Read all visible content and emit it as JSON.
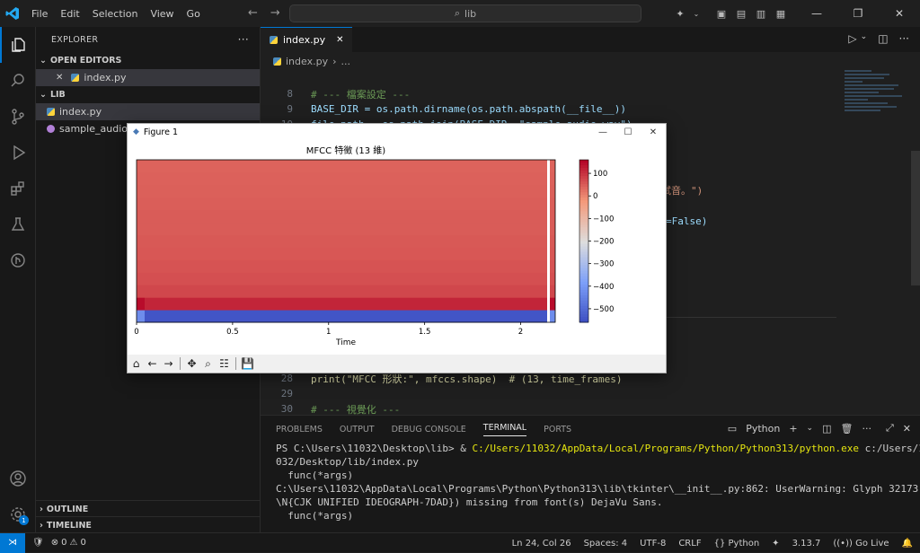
{
  "menu": [
    "File",
    "Edit",
    "Selection",
    "View",
    "Go"
  ],
  "search": {
    "text": "lib"
  },
  "sidebar": {
    "title": "EXPLORER",
    "open_editors_label": "OPEN EDITORS",
    "open_editors": [
      {
        "name": "index.py"
      }
    ],
    "folder_label": "LIB",
    "files": [
      {
        "name": "index.py"
      },
      {
        "name": "sample_audio.wav"
      }
    ],
    "outline_label": "OUTLINE",
    "timeline_label": "TIMELINE"
  },
  "tab": {
    "label": "index.py"
  },
  "breadcrumb": {
    "file": "index.py",
    "rest": "..."
  },
  "code_lines": [
    {
      "n": "8",
      "t": ""
    },
    {
      "n": "9",
      "t": "BASE_DIR = os.path.dirname(os.path.abspath(__file__))"
    },
    {
      "n": "10",
      "t": "file_path = os.path.join(BASE_DIR, \"sample_audio.wav\")"
    },
    {
      "n": "28",
      "t": "print(\"MFCC 形狀:\", mfccs.shape)  # (13, time_frames)"
    },
    {
      "n": "29",
      "t": ""
    },
    {
      "n": "30",
      "t": "# --- 視覺化 ---"
    }
  ],
  "code_comment_8": "# --- 檔案設定 ---",
  "code_fragment_a": "測試音。\")",
  "code_fragment_b": "=False)",
  "panel": {
    "tabs": [
      "PROBLEMS",
      "OUTPUT",
      "DEBUG CONSOLE",
      "TERMINAL",
      "PORTS"
    ],
    "active_tab": "TERMINAL",
    "shell": "Python",
    "terminal": [
      {
        "text": "PS C:\\Users\\11032\\Desktop\\lib> & ",
        "cmd": "C:/Users/11032/AppData/Local/Programs/Python/Python313/python.exe",
        "rest": " c:/Users/11"
      },
      {
        "text": "032/Desktop/lib/index.py",
        "cmd": "",
        "rest": ""
      },
      {
        "text": "  func(*args)",
        "cmd": "",
        "rest": ""
      },
      {
        "text": "C:\\Users\\11032\\AppData\\Local\\Programs\\Python\\Python313\\lib\\tkinter\\__init__.py:862: UserWarning: Glyph 32173 (",
        "cmd": "",
        "rest": ""
      },
      {
        "text": "\\N{CJK UNIFIED IDEOGRAPH-7DAD}) missing from font(s) DejaVu Sans.",
        "cmd": "",
        "rest": ""
      },
      {
        "text": "  func(*args)",
        "cmd": "",
        "rest": ""
      }
    ]
  },
  "status": {
    "errors": "0",
    "warnings": "0",
    "position": "Ln 24, Col 26",
    "spaces": "Spaces: 4",
    "encoding": "UTF-8",
    "eol": "CRLF",
    "language": "Python",
    "version": "3.13.7",
    "golive": "Go Live"
  },
  "figure": {
    "window_title": "Figure 1"
  },
  "chart_data": {
    "type": "heatmap",
    "title": "MFCC 特徵 (13 維)",
    "xlabel": "Time",
    "ylabel": "",
    "xticks": [
      "0",
      "0.5",
      "1",
      "1.5",
      "2"
    ],
    "xlim": [
      0,
      2.18
    ],
    "rows": 13,
    "colorbar": {
      "ticks": [
        100,
        0,
        -100,
        -200,
        -300,
        -400,
        -500
      ],
      "range": [
        -560,
        160
      ],
      "cmap": "coolwarm"
    },
    "row_values": [
      -540,
      120,
      80,
      70,
      65,
      60,
      58,
      55,
      55,
      52,
      50,
      48,
      46
    ],
    "edge_column_values": [
      -420,
      150
    ]
  }
}
